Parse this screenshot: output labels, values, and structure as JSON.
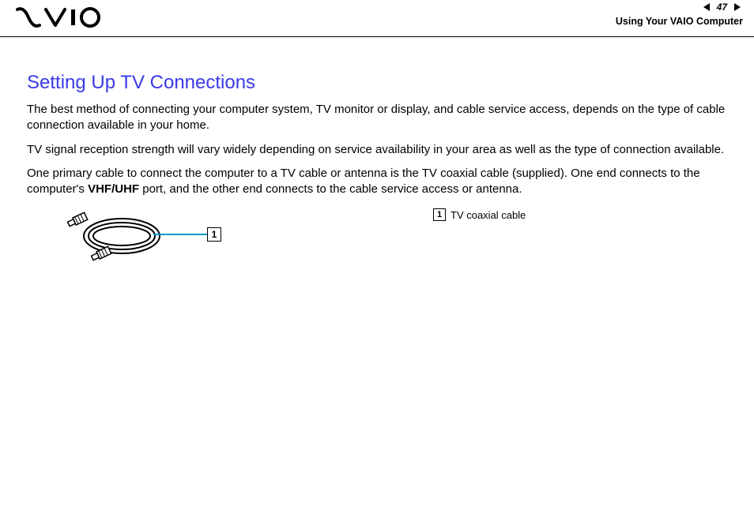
{
  "header": {
    "logo_text": "",
    "page_number": "47",
    "breadcrumb": "Using Your VAIO Computer"
  },
  "content": {
    "heading": "Setting Up TV Connections",
    "para1": "The best method of connecting your computer system, TV monitor or display, and cable service access, depends on the type of cable connection available in your home.",
    "para2": "TV signal reception strength will vary widely depending on service availability in your area as well as the type of connection available.",
    "para3_a": "One primary cable to connect the computer to a TV cable or antenna is the TV coaxial cable (supplied). One end connects to the computer's ",
    "para3_bold": "VHF/UHF",
    "para3_b": " port, and the other end connects to the cable service access or antenna."
  },
  "figure": {
    "callout_number": "1",
    "legend_number": "1",
    "legend_label": "TV coaxial cable"
  }
}
